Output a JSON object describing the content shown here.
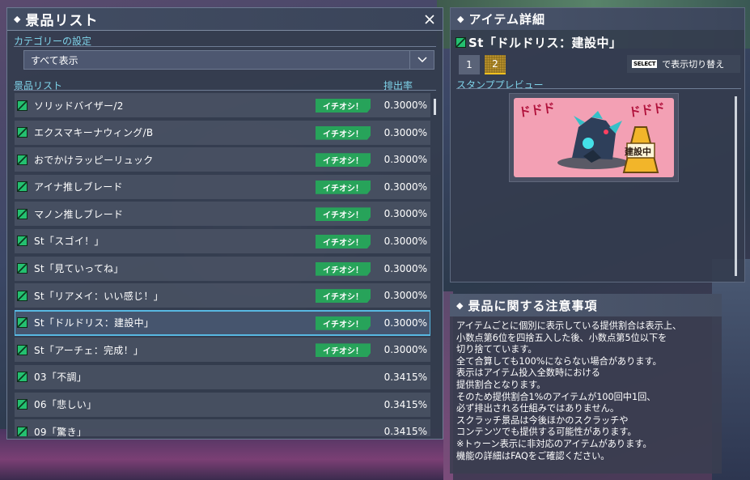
{
  "window_title": "景品リスト",
  "category": {
    "label": "カテゴリーの設定",
    "selected": "すべて表示"
  },
  "list_header": {
    "label": "景品リスト",
    "rate_label": "排出率"
  },
  "badge_label": "イチオシ！",
  "items": [
    {
      "name": "ソリッドバイザー/2",
      "rate": "0.3000%",
      "badge": true,
      "selected": false
    },
    {
      "name": "エクスマキーナウィング/B",
      "rate": "0.3000%",
      "badge": true,
      "selected": false
    },
    {
      "name": "おでかけラッピーリュック",
      "rate": "0.3000%",
      "badge": true,
      "selected": false
    },
    {
      "name": "アイナ推しブレード",
      "rate": "0.3000%",
      "badge": true,
      "selected": false
    },
    {
      "name": "マノン推しブレード",
      "rate": "0.3000%",
      "badge": true,
      "selected": false
    },
    {
      "name": "St「スゴイ！」",
      "rate": "0.3000%",
      "badge": true,
      "selected": false
    },
    {
      "name": "St「見ていってね」",
      "rate": "0.3000%",
      "badge": true,
      "selected": false
    },
    {
      "name": "St「リアメイ：いい感じ！」",
      "rate": "0.3000%",
      "badge": true,
      "selected": false
    },
    {
      "name": "St「ドルドリス：建設中」",
      "rate": "0.3000%",
      "badge": true,
      "selected": true
    },
    {
      "name": "St「アーチェ：完成！」",
      "rate": "0.3000%",
      "badge": true,
      "selected": false
    },
    {
      "name": "03「不調」",
      "rate": "0.3415%",
      "badge": false,
      "selected": false
    },
    {
      "name": "06「悲しい」",
      "rate": "0.3415%",
      "badge": false,
      "selected": false
    },
    {
      "name": "09「驚き」",
      "rate": "0.3415%",
      "badge": false,
      "selected": false
    }
  ],
  "detail": {
    "title": "アイテム詳細",
    "item_name": "St「ドルドリス：建設中」",
    "pages": [
      "1",
      "2"
    ],
    "active_page": "2",
    "select_key": "SELECT",
    "toggle_hint": "で表示切り替え",
    "preview_label": "スタンププレビュー",
    "stamp_text": {
      "sfx_left": "ドドド",
      "sfx_right": "ドドド",
      "sign": "建設中"
    }
  },
  "notes": {
    "title": "景品に関する注意事項",
    "lines": [
      "アイテムごとに個別に表示している提供割合は表示上、",
      "小数点第6位を四捨五入した後、小数点第5位以下を",
      "切り捨てています。",
      "全て合算しても100%にならない場合があります。",
      "表示はアイテム投入全数時における",
      "提供割合となります。",
      "そのため提供割合1%のアイテムが100回中1回、",
      "必ず排出される仕組みではありません。",
      "スクラッチ景品は今後ほかのスクラッチや",
      "コンテンツでも提供する可能性があります。",
      "※トゥーン表示に非対応のアイテムがあります。",
      "機能の詳細はFAQをご確認ください。"
    ]
  },
  "colors": {
    "accent_cyan": "#7fd4ea",
    "badge_green": "#27a35a",
    "selection_blue": "#58b8e2",
    "active_tab_gold": "#f0c020"
  }
}
